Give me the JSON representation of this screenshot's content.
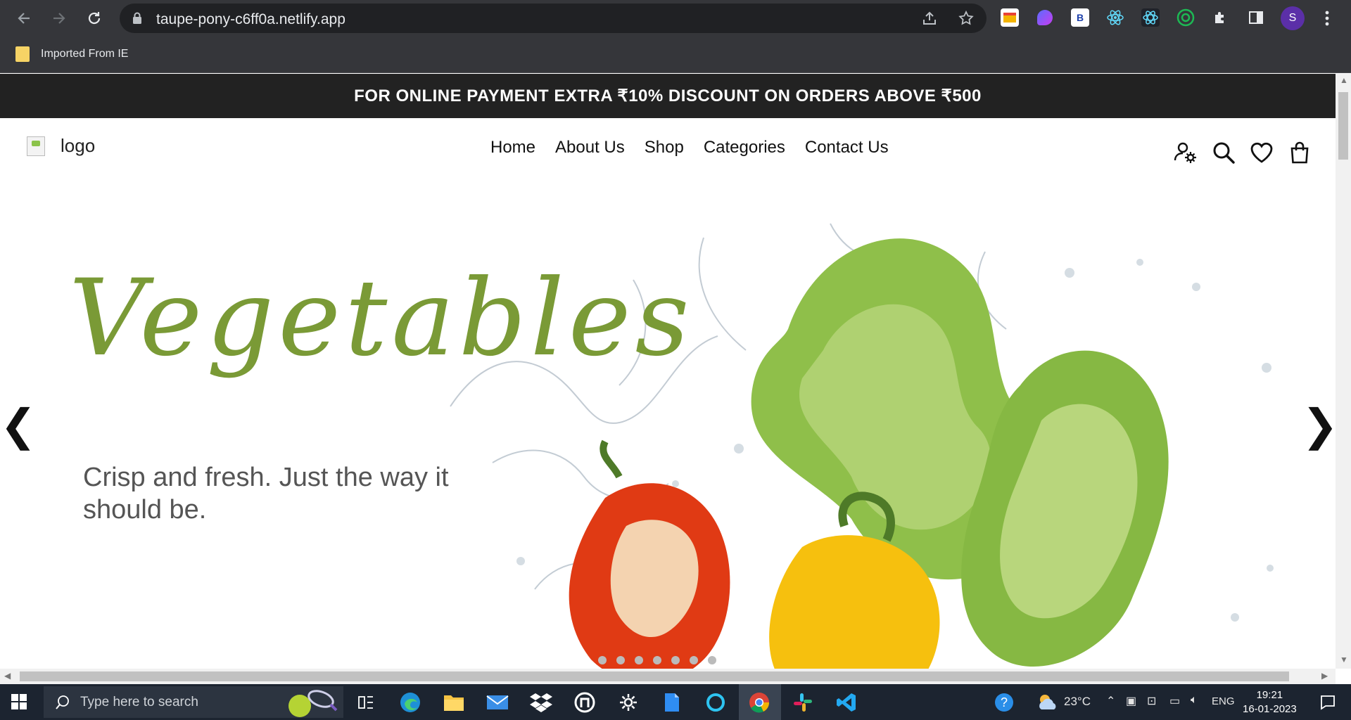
{
  "browser": {
    "url": "taupe-pony-c6ff0a.netlify.app",
    "bookmark_label": "Imported From IE",
    "avatar_letter": "S",
    "extension_b_label": "B"
  },
  "site": {
    "promo_text": "FOR ONLINE PAYMENT EXTRA ₹10% DISCOUNT ON ORDERS ABOVE ₹500",
    "logo_alt": "logo",
    "nav": [
      "Home",
      "About Us",
      "Shop",
      "Categories",
      "Contact Us"
    ],
    "header_icons": [
      "account-settings-icon",
      "search-icon",
      "heart-icon",
      "shopping-bag-icon"
    ]
  },
  "hero": {
    "title": "Vegetables",
    "subtitle": "Crisp and fresh. Just the way it should be.",
    "prev_arrow": "❮",
    "next_arrow": "❯",
    "slide_count": 7,
    "title_color": "#7a9a36"
  },
  "taskbar": {
    "search_placeholder": "Type here to search",
    "weather": "23°C",
    "language": "ENG",
    "time": "19:21",
    "date": "16-01-2023"
  }
}
